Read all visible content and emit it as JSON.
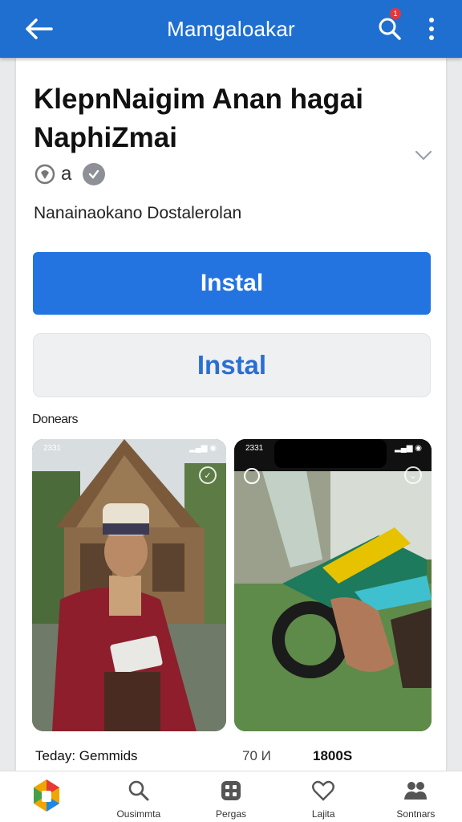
{
  "appbar": {
    "title": "Mamgaloakar",
    "back_icon": "arrow-left-icon",
    "search_icon": "search-icon",
    "badge": "1",
    "more_icon": "more-vert-icon",
    "color": "#1f6fd1"
  },
  "app": {
    "title": "KlepnNaigim Anan hagai NaphiZmai",
    "rating": "a",
    "subtitle": "Nanainaokano Dostalerolan"
  },
  "buttons": {
    "primary_label": "Instal",
    "secondary_label": "Instal",
    "primary_color": "#2374e1",
    "secondary_text_color": "#2a6fd1"
  },
  "screenshots": {
    "section_label": "Donears",
    "items": [
      {
        "status_time": "2331"
      },
      {
        "status_time": "2331"
      }
    ]
  },
  "captions": {
    "left": "Teday: Gemmids",
    "mid": "70 И",
    "right": "1800S"
  },
  "bottom_nav": {
    "items": [
      {
        "label": "",
        "icon": "app-logo-icon"
      },
      {
        "label": "Ousimmta",
        "icon": "search-icon"
      },
      {
        "label": "Pergas",
        "icon": "apps-grid-icon"
      },
      {
        "label": "Lajita",
        "icon": "heart-icon"
      },
      {
        "label": "Sontnars",
        "icon": "people-icon"
      }
    ]
  }
}
